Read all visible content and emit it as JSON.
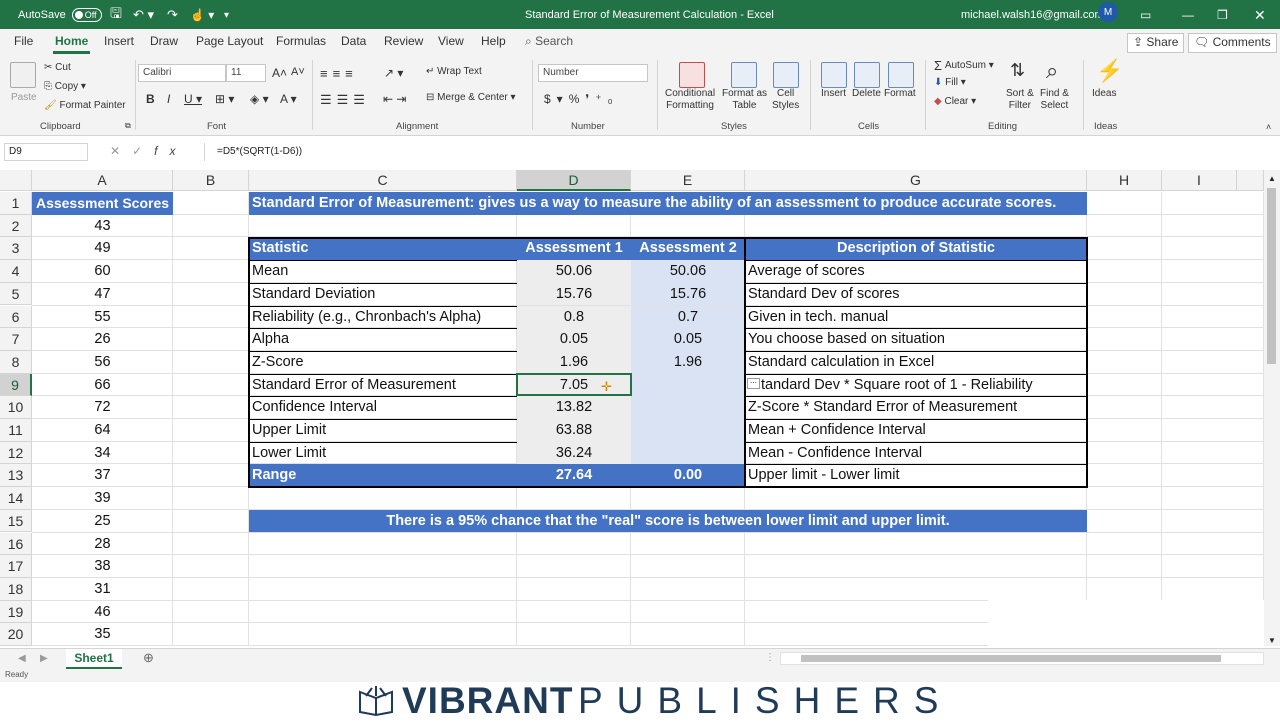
{
  "titlebar": {
    "autosave": "AutoSave",
    "autosave_state": "Off",
    "title": "Standard Error of Measurement Calculation  -  Excel",
    "user": "michael.walsh16@gmail.com",
    "avatar": "M"
  },
  "tabs": [
    "File",
    "Home",
    "Insert",
    "Draw",
    "Page Layout",
    "Formulas",
    "Data",
    "Review",
    "View",
    "Help"
  ],
  "search": "Search",
  "share": "Share",
  "comments": "Comments",
  "ribbon": {
    "clipboard": {
      "paste": "Paste",
      "cut": "Cut",
      "copy": "Copy",
      "format_painter": "Format Painter",
      "label": "Clipboard"
    },
    "font": {
      "name": "Calibri",
      "size": "11",
      "label": "Font"
    },
    "alignment": {
      "wrap": "Wrap Text",
      "merge": "Merge & Center",
      "label": "Alignment"
    },
    "number": {
      "format": "Number",
      "label": "Number"
    },
    "styles": {
      "cond1": "Conditional",
      "cond2": "Formatting",
      "fmt1": "Format as",
      "fmt2": "Table",
      "cell1": "Cell",
      "cell2": "Styles",
      "label": "Styles"
    },
    "cells": {
      "insert": "Insert",
      "delete": "Delete",
      "format": "Format",
      "label": "Cells"
    },
    "editing": {
      "autosum": "AutoSum",
      "fill": "Fill",
      "clear": "Clear",
      "sort1": "Sort &",
      "sort2": "Filter",
      "find1": "Find &",
      "find2": "Select",
      "label": "Editing"
    },
    "ideas": {
      "btn": "Ideas",
      "label": "Ideas"
    }
  },
  "namebox": "D9",
  "formula": "=D5*(SQRT(1-D6))",
  "columns": [
    "A",
    "B",
    "C",
    "D",
    "E",
    "G",
    "H",
    "I"
  ],
  "rows": [
    "1",
    "2",
    "3",
    "4",
    "5",
    "6",
    "7",
    "8",
    "9",
    "10",
    "11",
    "12",
    "13",
    "14",
    "15",
    "16",
    "17",
    "18",
    "19",
    "20"
  ],
  "colA": {
    "header": "Assessment Scores",
    "scores": [
      "43",
      "49",
      "60",
      "47",
      "55",
      "26",
      "56",
      "66",
      "72",
      "64",
      "34",
      "37",
      "39",
      "25",
      "28",
      "38",
      "31",
      "46",
      "35"
    ]
  },
  "banner": "Standard Error of Measurement:  gives us a way to measure the ability of an assessment to produce accurate scores.",
  "table": {
    "headers": [
      "Statistic",
      "Assessment 1",
      "Assessment 2",
      "Description of Statistic"
    ],
    "rows": [
      [
        "Mean",
        "50.06",
        "50.06",
        "Average of scores"
      ],
      [
        "Standard Deviation",
        "15.76",
        "15.76",
        "Standard Dev of scores"
      ],
      [
        "Reliability (e.g., Chronbach's Alpha)",
        "0.8",
        "0.7",
        "Given in tech. manual"
      ],
      [
        "Alpha",
        "0.05",
        "0.05",
        "You choose based on situation"
      ],
      [
        "Z-Score",
        "1.96",
        "1.96",
        "Standard calculation in Excel"
      ],
      [
        "Standard Error of Measurement",
        "7.05",
        "",
        "tandard Dev * Square root of 1 - Reliability"
      ],
      [
        "Confidence Interval",
        "13.82",
        "",
        "Z-Score * Standard Error of Measurement"
      ],
      [
        "Upper Limit",
        "63.88",
        "",
        "Mean + Confidence Interval"
      ],
      [
        "Lower Limit",
        "36.24",
        "",
        "Mean - Confidence Interval"
      ]
    ],
    "range": [
      "Range",
      "27.64",
      "0.00",
      "Upper limit - Lower limit"
    ]
  },
  "note": "There is a 95% chance that the \"real\" score is between lower limit and upper limit.",
  "sheet": "Sheet1",
  "status": "Ready",
  "brand": {
    "bold": "VIBRANT",
    "light": "PUBLISHERS"
  },
  "accent": "#217346",
  "header_blue": "#4472c4"
}
